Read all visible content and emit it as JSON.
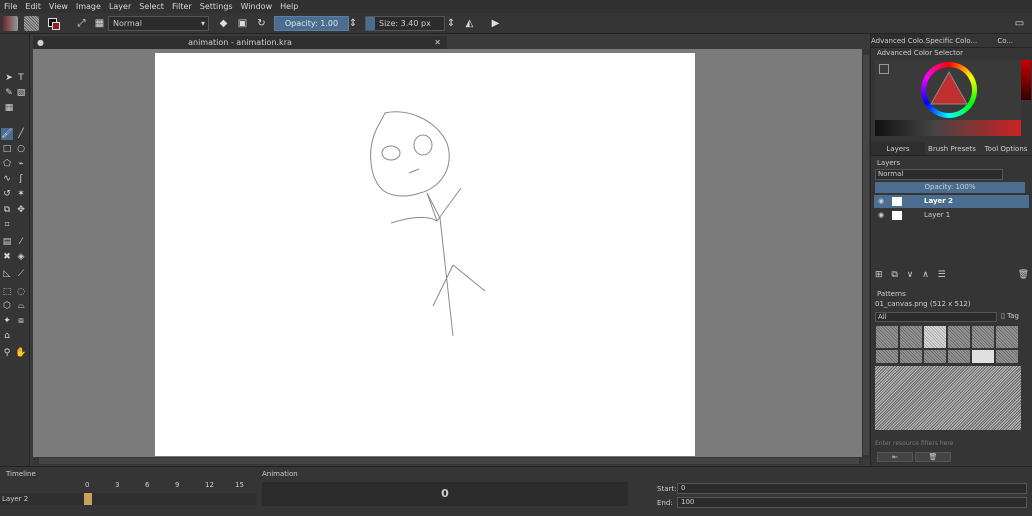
{
  "menu": [
    "File",
    "Edit",
    "View",
    "Image",
    "Layer",
    "Select",
    "Filter",
    "Settings",
    "Window",
    "Help"
  ],
  "toolbar": {
    "blend_mode": "Normal",
    "opacity": "Opacity: 1.00",
    "size": "Size: 3.40 px"
  },
  "document": {
    "tab_title": "animation - animation.kra"
  },
  "dock_tabs": [
    "Advanced Colo...",
    "Specific Colo...",
    "Co..."
  ],
  "color_selector": {
    "title": "Advanced Color Selector"
  },
  "layer_dock_tabs": [
    "Layers",
    "Brush Presets",
    "Tool Options"
  ],
  "layers": {
    "title": "Layers",
    "blend_mode": "Normal",
    "opacity": "Opacity:  100%",
    "items": [
      {
        "name": "Layer 2",
        "selected": true
      },
      {
        "name": "Layer 1",
        "selected": false
      }
    ]
  },
  "patterns": {
    "title": "Patterns",
    "current": "01_canvas.png (512 x 512)",
    "filter": "All",
    "tag": "Tag",
    "search_placeholder": "Enter resource filters here"
  },
  "timeline": {
    "title": "Timeline",
    "layer": "Layer 2",
    "frames": [
      "0",
      "3",
      "6",
      "9",
      "12",
      "15"
    ]
  },
  "animation": {
    "title": "Animation",
    "current_frame": "0",
    "start_label": "Start:",
    "start_value": "0",
    "end_label": "End:",
    "end_value": "100"
  },
  "colors": {
    "accent": "#4b6d8f",
    "canvas_bg": "#7b7b7b",
    "paper": "#ffffff"
  }
}
